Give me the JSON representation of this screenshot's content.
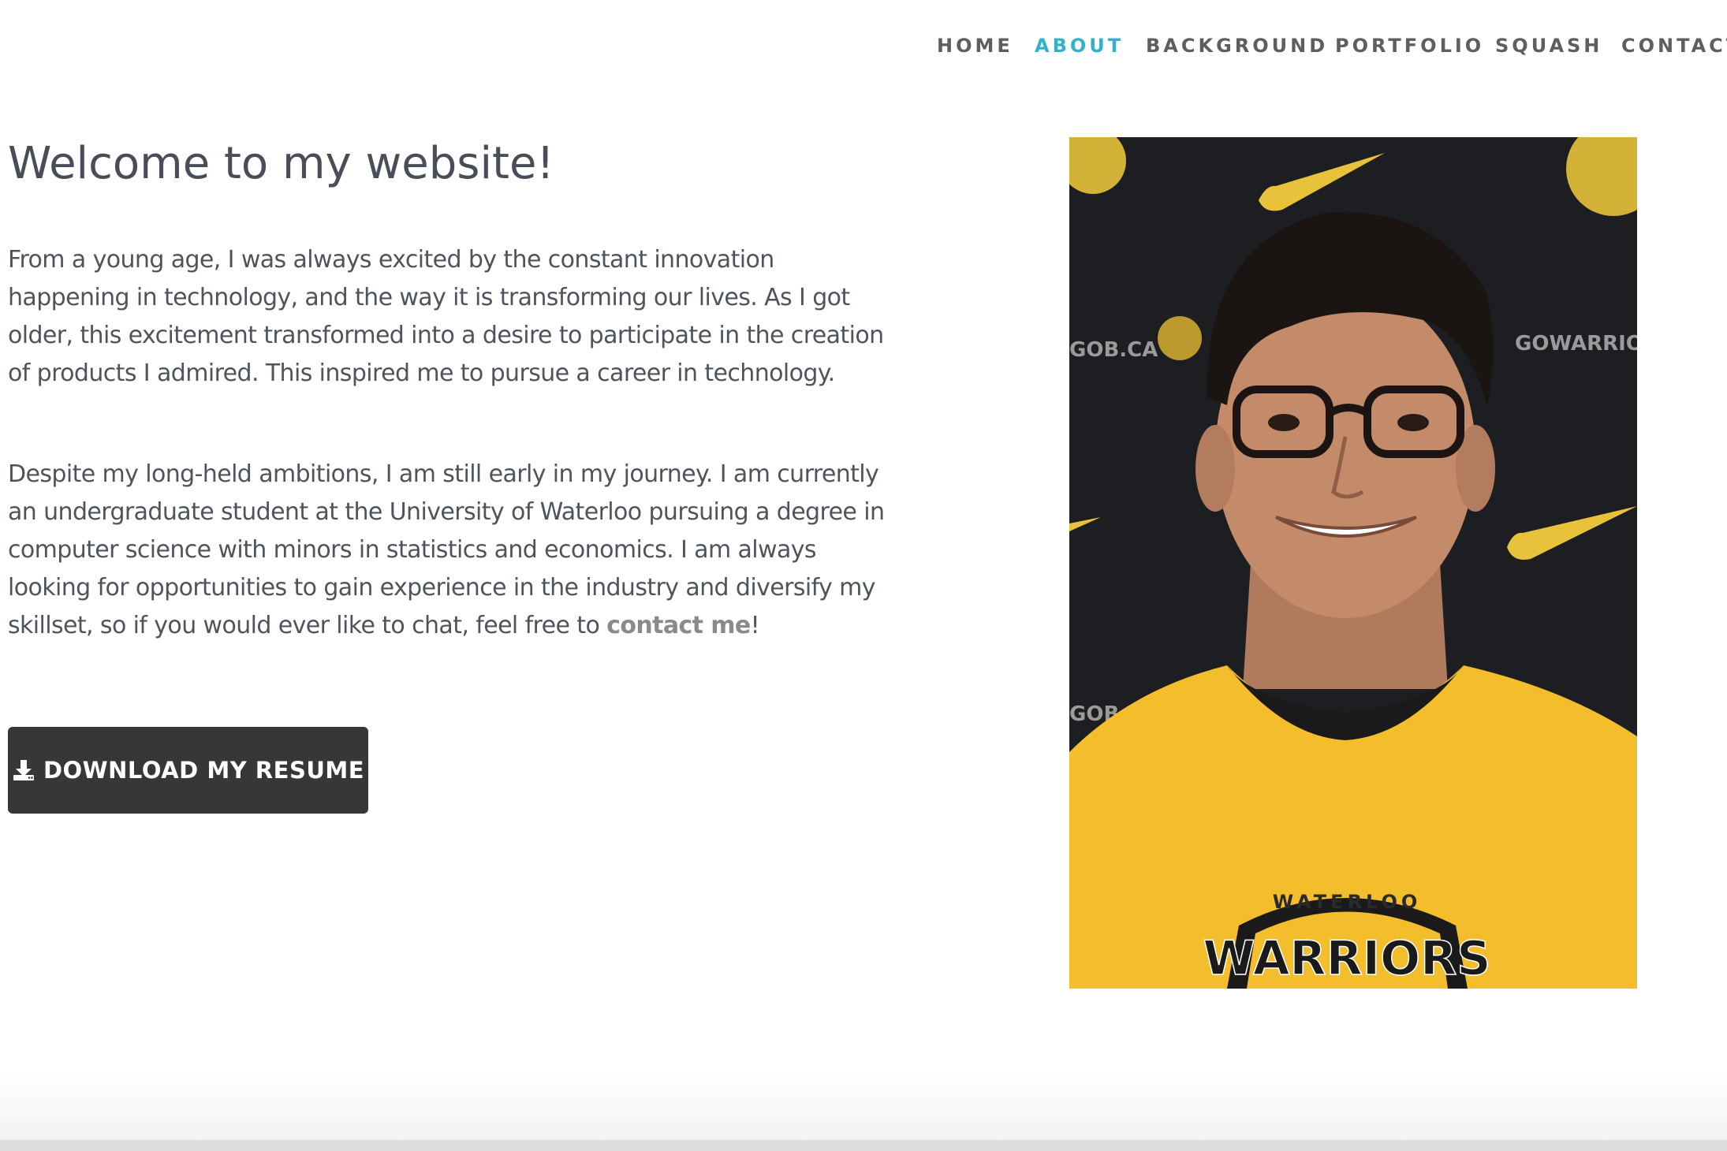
{
  "nav": {
    "items": [
      {
        "label": "HOME",
        "active": false
      },
      {
        "label": "ABOUT",
        "active": true
      },
      {
        "label": "BACKGROUND",
        "active": false
      },
      {
        "label": "PORTFOLIO",
        "active": false
      },
      {
        "label": "SQUASH",
        "active": false
      },
      {
        "label": "CONTACT",
        "active": false
      }
    ],
    "active_color": "#2fb3c9",
    "color": "#5e5e5e"
  },
  "main": {
    "heading": "Welcome to my website!",
    "paragraph1": "From a young age, I was always excited by the constant innovation happening in technology, and the way it is transforming our lives. As I got older, this excitement transformed into a desire to participate in the creation of products I admired. This inspired me to pursue a career in technology.",
    "paragraph2_before": "Despite my long-held ambitions, I am still early in my journey. I am currently an undergraduate student at the University of Waterloo pursuing a degree in computer science with minors in statistics and economics. I am always looking for opportunities to gain experience in the industry and diversify my skillset, so if you would ever like to chat, feel free to ",
    "paragraph2_link": "contact me",
    "paragraph2_after": "!",
    "resume_button": "DOWNLOAD MY RESUME",
    "resume_icon": "download-icon"
  },
  "photo": {
    "shirt_text_top": "WATERLOO",
    "shirt_text_main": "WARRIORS",
    "backdrop_text_1": "GOWARRIORS",
    "backdrop_text_2": "GOB.CA",
    "shirt_color": "#f3bd2c",
    "backdrop_color": "#1d1e22"
  }
}
